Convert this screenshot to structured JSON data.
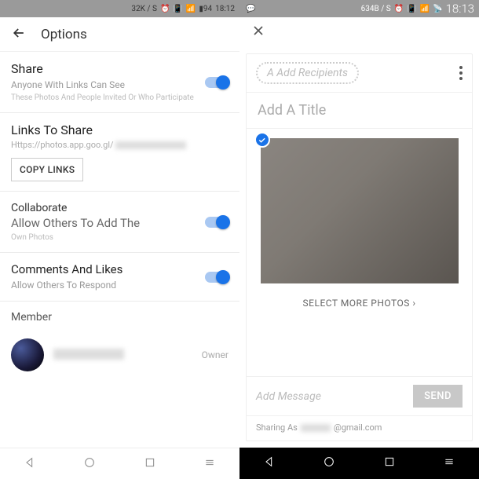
{
  "left": {
    "status": {
      "speed": "32K / S",
      "battery": "94",
      "time": "18:12"
    },
    "app_bar": {
      "title": "Options"
    },
    "share": {
      "title": "Share",
      "subtitle": "Anyone With Links Can See",
      "caption": "These Photos And People Invited Or Who Participate"
    },
    "links": {
      "title": "Links To Share",
      "url_prefix": "Https://photos.app.goo.gl/",
      "copy_label": "COPY LINKS"
    },
    "collaborate": {
      "title": "Collaborate",
      "subtitle": "Allow Others To Add The",
      "caption": "Own Photos"
    },
    "comments": {
      "title": "Comments And Likes",
      "subtitle": "Allow Others To Respond"
    },
    "member": {
      "heading": "Member",
      "role": "Owner"
    }
  },
  "right": {
    "status": {
      "speed": "634B / S",
      "time": "18:13"
    },
    "recipients_placeholder": "A Add Recipients",
    "title_placeholder": "Add A Title",
    "select_more": "SELECT MORE PHOTOS",
    "message_placeholder": "Add Message",
    "send_label": "SEND",
    "sharing_as_label": "Sharing As",
    "sharing_domain": "@gmail.com"
  }
}
